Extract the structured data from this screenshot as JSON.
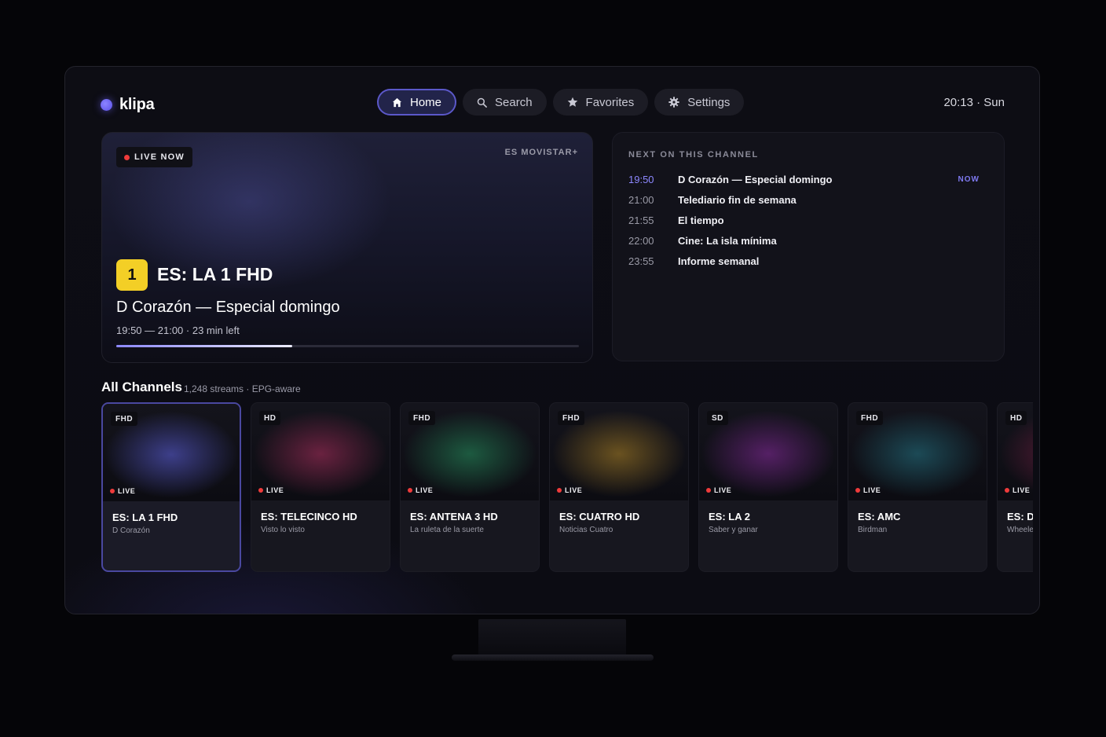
{
  "app": {
    "name": "klipa"
  },
  "nav": [
    {
      "label": "Home",
      "icon": "home-icon",
      "active": true
    },
    {
      "label": "Search",
      "icon": "search-icon",
      "active": false
    },
    {
      "label": "Favorites",
      "icon": "star-icon",
      "active": false
    },
    {
      "label": "Settings",
      "icon": "gear-icon",
      "active": false
    }
  ],
  "clock": "20:13 · Sun",
  "hero": {
    "live_label": "LIVE NOW",
    "provider": "ES MOVISTAR+",
    "channel_number": "1",
    "channel_name": "ES: LA 1 FHD",
    "program_title": "D Corazón — Especial domingo",
    "program_time": "19:50 — 21:00 · 23 min left",
    "progress": 0.38
  },
  "schedule": {
    "title": "NEXT ON THIS CHANNEL",
    "now_label": "NOW",
    "items": [
      {
        "time": "19:50",
        "show": "D Corazón — Especial domingo",
        "now": true
      },
      {
        "time": "21:00",
        "show": "Telediario fin de semana",
        "now": false
      },
      {
        "time": "21:55",
        "show": "El tiempo",
        "now": false
      },
      {
        "time": "22:00",
        "show": "Cine: La isla mínima",
        "now": false
      },
      {
        "time": "23:55",
        "show": "Informe semanal",
        "now": false
      }
    ]
  },
  "channels": {
    "title": "All Channels",
    "subtitle": "1,248 streams · EPG-aware",
    "live_label": "LIVE",
    "items": [
      {
        "quality": "FHD",
        "name": "ES: LA 1 FHD",
        "program": "D Corazón",
        "color": "#3d3f8a",
        "selected": true
      },
      {
        "quality": "HD",
        "name": "ES: TELECINCO HD",
        "program": "Visto lo visto",
        "color": "#6a2240"
      },
      {
        "quality": "FHD",
        "name": "ES: ANTENA 3 HD",
        "program": "La ruleta de la suerte",
        "color": "#1d5a40"
      },
      {
        "quality": "FHD",
        "name": "ES: CUATRO HD",
        "program": "Noticias Cuatro",
        "color": "#6a5220"
      },
      {
        "quality": "SD",
        "name": "ES: LA 2",
        "program": "Saber y ganar",
        "color": "#552065"
      },
      {
        "quality": "FHD",
        "name": "ES: AMC",
        "program": "Birdman",
        "color": "#1c4a56"
      },
      {
        "quality": "HD",
        "name": "ES: DM",
        "program": "Wheeler",
        "color": "#5a1c38"
      }
    ]
  }
}
